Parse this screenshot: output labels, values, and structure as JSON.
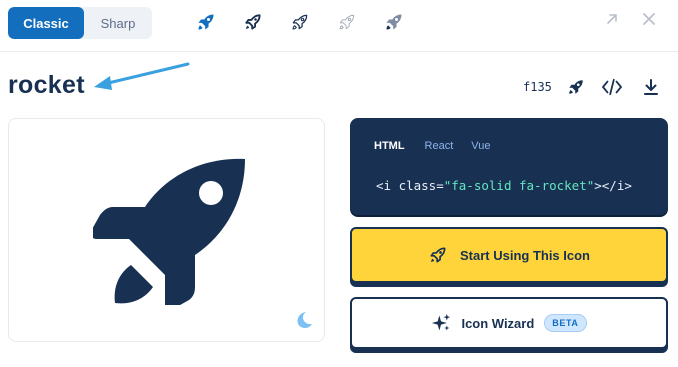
{
  "style_toggle": {
    "classic_label": "Classic",
    "sharp_label": "Sharp"
  },
  "style_icons": [
    "rocket-solid-icon",
    "rocket-regular-icon",
    "rocket-light-icon",
    "rocket-thin-icon",
    "rocket-duotone-icon"
  ],
  "icon": {
    "name": "rocket",
    "unicode": "f135"
  },
  "code": {
    "tabs": [
      "HTML",
      "React",
      "Vue"
    ],
    "prefix": "<i class=",
    "class_string": "\"fa-solid fa-rocket\"",
    "suffix": "></i>"
  },
  "buttons": {
    "start_label": "Start Using This Icon",
    "wizard_label": "Icon Wizard",
    "beta_label": "BETA"
  },
  "colors": {
    "navy": "#183153",
    "blue": "#146ebe",
    "yellow": "#ffd43b",
    "teal": "#63e6be",
    "arrow": "#3aa0e0"
  }
}
